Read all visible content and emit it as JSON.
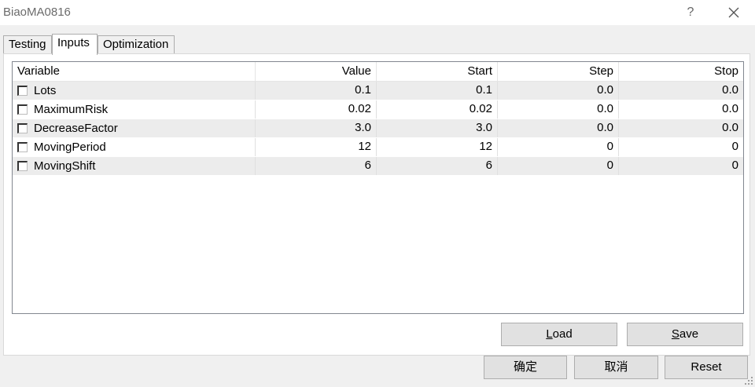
{
  "window": {
    "title": "BiaoMA0816",
    "help_label": "?"
  },
  "tabs": [
    {
      "label": "Testing",
      "active": false
    },
    {
      "label": "Inputs",
      "active": true
    },
    {
      "label": "Optimization",
      "active": false
    }
  ],
  "grid": {
    "columns": [
      "Variable",
      "Value",
      "Start",
      "Step",
      "Stop"
    ],
    "rows": [
      {
        "checked": false,
        "variable": "Lots",
        "value": "0.1",
        "start": "0.1",
        "step": "0.0",
        "stop": "0.0"
      },
      {
        "checked": false,
        "variable": "MaximumRisk",
        "value": "0.02",
        "start": "0.02",
        "step": "0.0",
        "stop": "0.0"
      },
      {
        "checked": false,
        "variable": "DecreaseFactor",
        "value": "3.0",
        "start": "3.0",
        "step": "0.0",
        "stop": "0.0"
      },
      {
        "checked": false,
        "variable": "MovingPeriod",
        "value": "12",
        "start": "12",
        "step": "0",
        "stop": "0"
      },
      {
        "checked": false,
        "variable": "MovingShift",
        "value": "6",
        "start": "6",
        "step": "0",
        "stop": "0"
      }
    ]
  },
  "buttons": {
    "load_prefix": "",
    "load_mnemonic": "L",
    "load_rest": "oad",
    "save_mnemonic": "S",
    "save_rest": "ave",
    "ok": "确定",
    "cancel": "取消",
    "reset": "Reset"
  }
}
